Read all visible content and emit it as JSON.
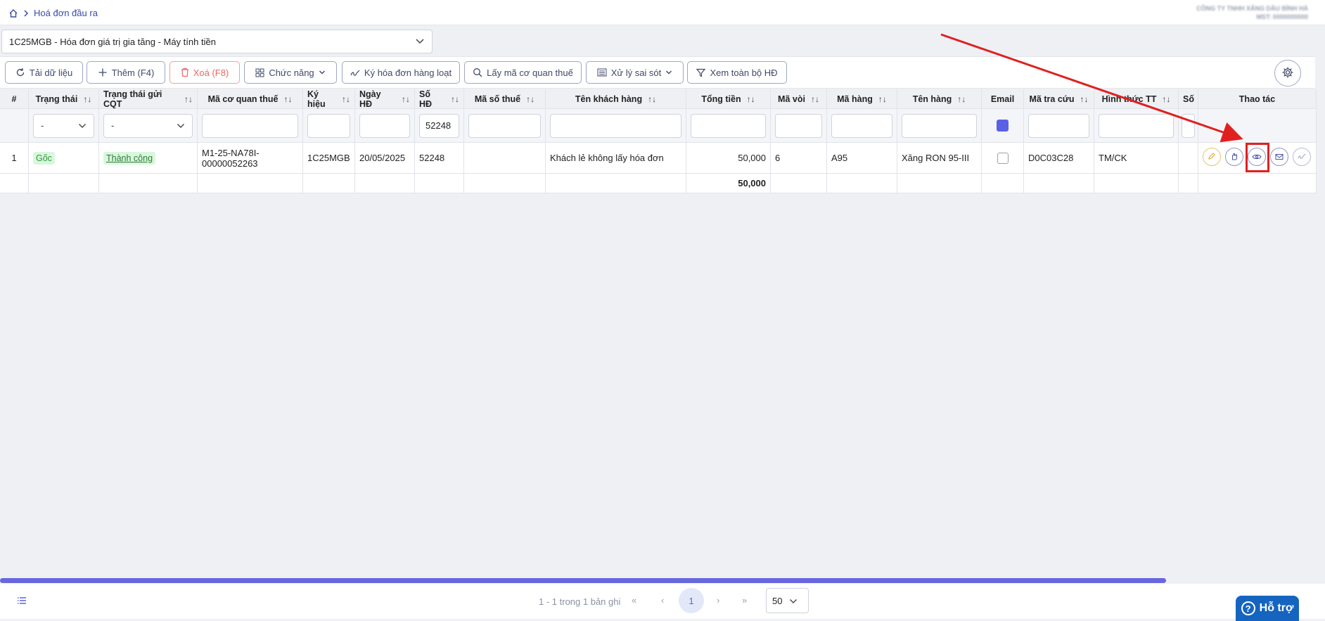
{
  "breadcrumb": {
    "current": "Hoá đơn đầu ra"
  },
  "company": {
    "name": "CÔNG TY TNHH XĂNG DẦU BÌNH HÀ",
    "tax_code": "MST: 0000000000"
  },
  "invoice_type": {
    "selected": "1C25MGB - Hóa đơn giá trị gia tăng - Máy tính tiền"
  },
  "toolbar": {
    "reload": "Tải dữ liệu",
    "add": "Thêm (F4)",
    "delete": "Xoá (F8)",
    "functions": "Chức năng",
    "bulk_sign": "Ký hóa đơn hàng loạt",
    "get_tax_code": "Lấy mã cơ quan thuế",
    "handle_errors": "Xử lý sai sót",
    "view_all": "Xem toàn bộ HĐ"
  },
  "columns": {
    "index": "#",
    "status": "Trạng thái",
    "send_status": "Trạng thái gửi CQT",
    "tax_authority_code": "Mã cơ quan thuế",
    "symbol": "Ký hiệu",
    "invoice_date": "Ngày HĐ",
    "invoice_no": "Số HĐ",
    "tax_id": "Mã số thuế",
    "customer": "Tên khách hàng",
    "total": "Tổng tiền",
    "nozzle": "Mã vòi",
    "item_code": "Mã hàng",
    "item_name": "Tên hàng",
    "email": "Email",
    "lookup_code": "Mã tra cứu",
    "payment": "Hình thức TT",
    "more": "Số",
    "actions": "Thao tác"
  },
  "filters": {
    "status": "-",
    "send_status": "-",
    "invoice_no": "52248"
  },
  "rows": [
    {
      "index": "1",
      "status": "Gốc",
      "send_status": "Thành công",
      "tax_authority_code_1": "M1-25-NA78I-",
      "tax_authority_code_2": "00000052263",
      "symbol": "1C25MGB",
      "invoice_date": "20/05/2025",
      "invoice_no": "52248",
      "tax_id": "",
      "customer": "Khách lẻ không lấy hóa đơn",
      "total": "50,000",
      "nozzle": "6",
      "item_code": "A95",
      "item_name": "Xăng RON 95-III",
      "email_checked": false,
      "lookup_code": "D0C03C28",
      "payment": "TM/CK"
    }
  ],
  "summary": {
    "total": "50,000"
  },
  "pagination": {
    "info": "1 - 1 trong 1 bản ghi",
    "first": "«",
    "prev": "‹",
    "current": "1",
    "next": "›",
    "last": "»",
    "page_size": "50"
  },
  "help": {
    "label": "Hỗ trợ"
  },
  "colors": {
    "accent": "#5b61e6",
    "highlight": "#e02020",
    "success_bg": "#d9f7dc",
    "help_bg": "#1565c0"
  },
  "icons": [
    "home-icon",
    "chevron-right-icon",
    "chevron-down-icon",
    "reload-icon",
    "plus-icon",
    "trash-icon",
    "grid-icon",
    "sign-icon",
    "search-icon",
    "list-icon",
    "filter-icon",
    "gear-icon",
    "sort-icon",
    "pencil-icon",
    "hand-icon",
    "eye-icon",
    "mail-icon",
    "signature-icon"
  ]
}
